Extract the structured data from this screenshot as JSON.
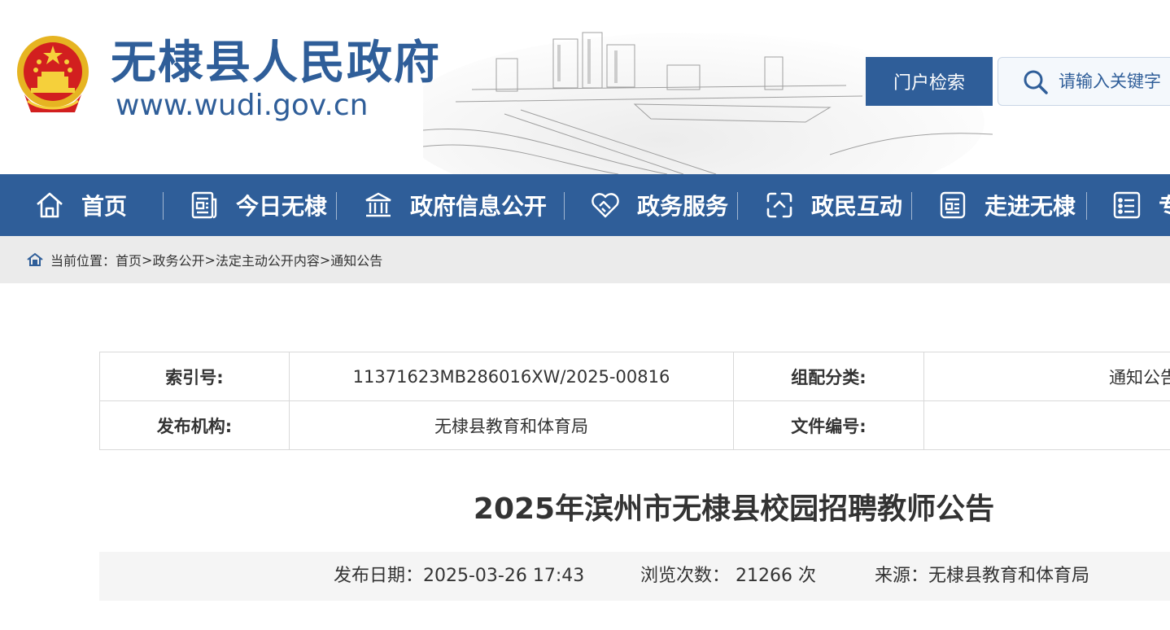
{
  "header": {
    "site_name": "无棣县人民政府",
    "site_url": "www.wudi.gov.cn",
    "search_button": "门户检索",
    "search_placeholder": "请输入关键字"
  },
  "nav": {
    "items": [
      {
        "label": "首页",
        "icon": "home-icon"
      },
      {
        "label": "今日无棣",
        "icon": "newspaper-icon"
      },
      {
        "label": "政府信息公开",
        "icon": "government-building-icon"
      },
      {
        "label": "政务服务",
        "icon": "handshake-heart-icon"
      },
      {
        "label": "政民互动",
        "icon": "interaction-icon"
      },
      {
        "label": "走进无棣",
        "icon": "document-icon"
      },
      {
        "label": "专",
        "icon": "list-icon"
      }
    ]
  },
  "breadcrumb": {
    "prefix": "当前位置：",
    "items": [
      "首页",
      "政务公开",
      "法定主动公开内容",
      "通知公告"
    ],
    "separator": ">"
  },
  "info": {
    "index_label": "索引号:",
    "index_value": "11371623MB286016XW/2025-00816",
    "category_label": "组配分类:",
    "category_value": "通知公告",
    "publisher_label": "发布机构:",
    "publisher_value": "无棣县教育和体育局",
    "docno_label": "文件编号:",
    "docno_value": ""
  },
  "article": {
    "title": "2025年滨州市无棣县校园招聘教师公告",
    "date": "发布日期：2025-03-26 17:43",
    "views": "浏览次数：  21266 次",
    "source": "来源：无棣县教育和体育局"
  },
  "colors": {
    "brand_blue": "#2f5e99",
    "breadcrumb_bg": "#ebebeb",
    "meta_bg": "#f5f5f5"
  }
}
